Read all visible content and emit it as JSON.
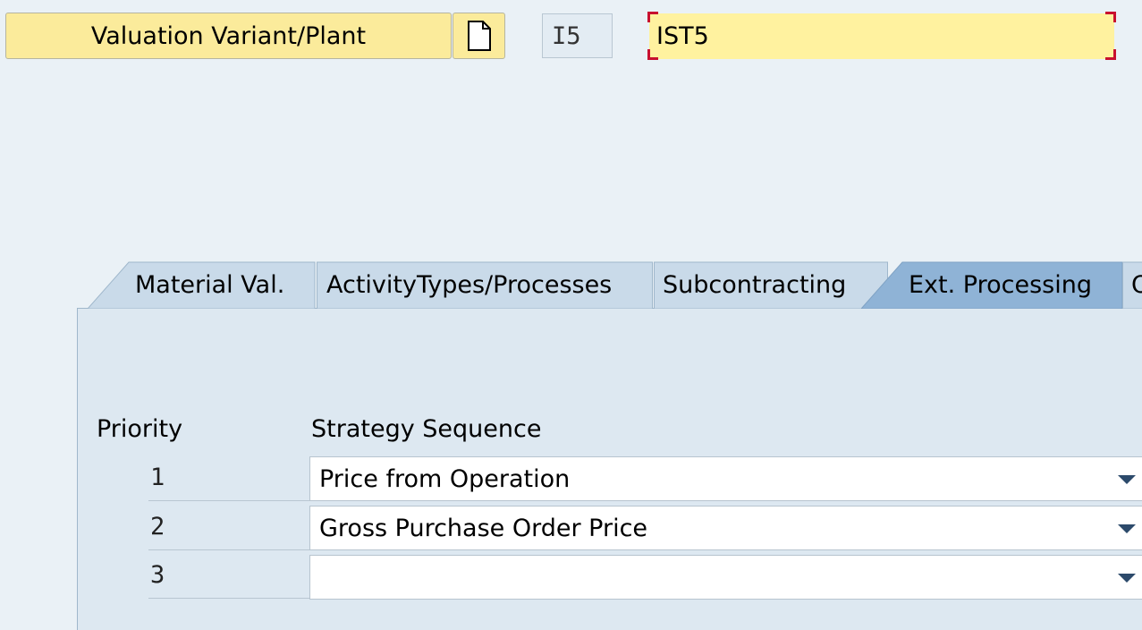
{
  "header": {
    "valuation_button_label": "Valuation Variant/Plant",
    "valuation_variant_code": "I5",
    "plant_value": "IST5"
  },
  "tabs": [
    {
      "label": "Material Val.",
      "active": false
    },
    {
      "label": "ActivityTypes/Processes",
      "active": false
    },
    {
      "label": "Subcontracting",
      "active": false
    },
    {
      "label": "Ext. Processing",
      "active": true
    },
    {
      "label": "O",
      "active": false
    }
  ],
  "table": {
    "priority_header": "Priority",
    "strategy_header": "Strategy Sequence",
    "rows": [
      {
        "priority": "1",
        "strategy": "Price from Operation"
      },
      {
        "priority": "2",
        "strategy": "Gross Purchase Order Price"
      },
      {
        "priority": "3",
        "strategy": ""
      }
    ]
  },
  "colors": {
    "background": "#eaf1f6",
    "button_yellow": "#fbeb9b",
    "input_yellow": "#fff29f",
    "required_marker": "#c8102e",
    "tab_inactive": "#c9dae9",
    "tab_active": "#8fb3d6",
    "dropdown_arrow": "#2c4a6b"
  }
}
